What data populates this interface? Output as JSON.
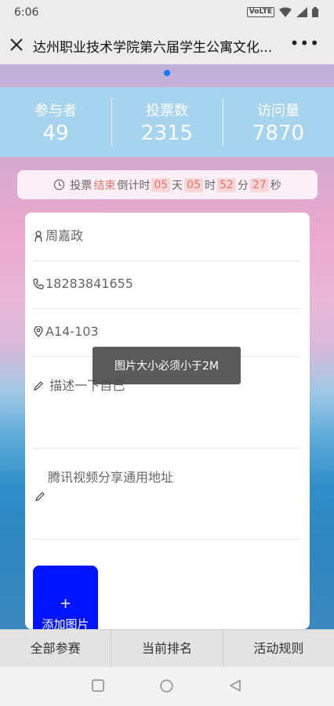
{
  "status_bar": {
    "time": "6:06",
    "volte": "VoLTE"
  },
  "nav": {
    "title": "达州职业技术学院第六届学生公寓文化...",
    "more": "•••"
  },
  "stats": [
    {
      "label": "参与者",
      "value": "49"
    },
    {
      "label": "投票数",
      "value": "2315"
    },
    {
      "label": "访问量",
      "value": "7870"
    }
  ],
  "countdown": {
    "prefix": "投票",
    "state": "结束",
    "label": "倒计时",
    "days": "05",
    "days_unit": "天",
    "hours": "05",
    "hours_unit": "时",
    "minutes": "52",
    "minutes_unit": "分",
    "seconds": "27",
    "seconds_unit": "秒"
  },
  "form": {
    "name": "周嘉政",
    "phone": "18283841655",
    "room": "A14-103",
    "description_placeholder": "描述一下自己",
    "video_placeholder": "腾讯视频分享通用地址",
    "add_image_plus": "+",
    "add_image_label": "添加图片"
  },
  "toast": "图片大小必须小于2M",
  "tabs": [
    "全部参赛",
    "当前排名",
    "活动规则"
  ],
  "colors": {
    "accent": "#1677ff",
    "stats_bg": "#a6d4ee",
    "add_button": "#0014ff",
    "countdown_highlight": "#e8736c"
  }
}
